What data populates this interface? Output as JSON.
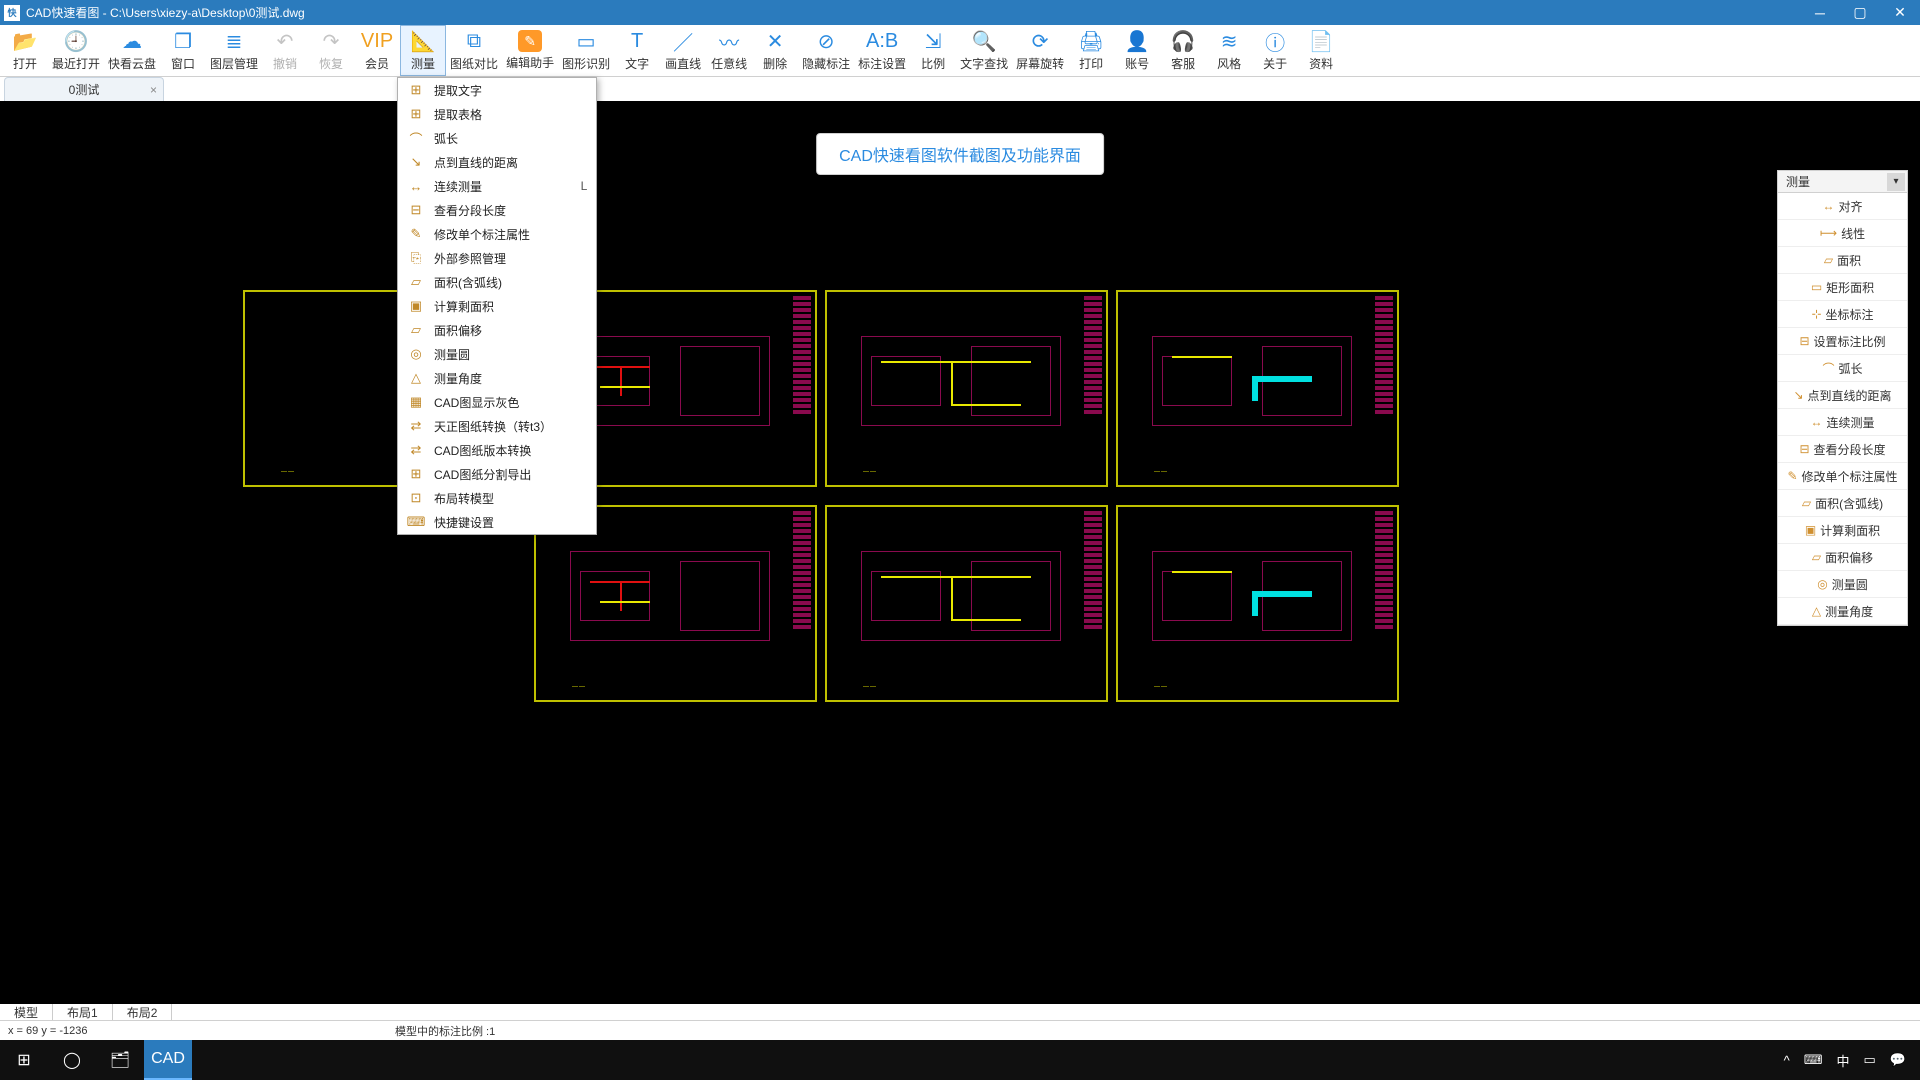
{
  "titlebar": {
    "app_badge": "快",
    "title": "CAD快速看图 - C:\\Users\\xiezy-a\\Desktop\\0测试.dwg"
  },
  "toolbar": [
    {
      "id": "open",
      "label": "打开",
      "icon": "📂"
    },
    {
      "id": "recent",
      "label": "最近打开",
      "icon": "🕘"
    },
    {
      "id": "cloud",
      "label": "快看云盘",
      "icon": "☁"
    },
    {
      "id": "window",
      "label": "窗口",
      "icon": "❐"
    },
    {
      "id": "layers",
      "label": "图层管理",
      "icon": "≣"
    },
    {
      "id": "undo",
      "label": "撤销",
      "icon": "↶",
      "disabled": true
    },
    {
      "id": "redo",
      "label": "恢复",
      "icon": "↷",
      "disabled": true
    },
    {
      "id": "vip",
      "label": "会员",
      "icon": "VIP",
      "vip": true
    },
    {
      "id": "measure",
      "label": "测量",
      "icon": "📐",
      "active": true
    },
    {
      "id": "compare",
      "label": "图纸对比",
      "icon": "⧉"
    },
    {
      "id": "edithelp",
      "label": "编辑助手",
      "icon": "✎",
      "orange": true
    },
    {
      "id": "shape",
      "label": "图形识别",
      "icon": "▭"
    },
    {
      "id": "text",
      "label": "文字",
      "icon": "T"
    },
    {
      "id": "line",
      "label": "画直线",
      "icon": "／"
    },
    {
      "id": "freeline",
      "label": "任意线",
      "icon": "〰"
    },
    {
      "id": "delete",
      "label": "删除",
      "icon": "✕"
    },
    {
      "id": "hidedim",
      "label": "隐藏标注",
      "icon": "⊘"
    },
    {
      "id": "dimset",
      "label": "标注设置",
      "icon": "A:B"
    },
    {
      "id": "scale",
      "label": "比例",
      "icon": "⇲"
    },
    {
      "id": "findtext",
      "label": "文字查找",
      "icon": "🔍"
    },
    {
      "id": "rotate",
      "label": "屏幕旋转",
      "icon": "⟳"
    },
    {
      "id": "print",
      "label": "打印",
      "icon": "🖨"
    },
    {
      "id": "account",
      "label": "账号",
      "icon": "👤"
    },
    {
      "id": "support",
      "label": "客服",
      "icon": "🎧"
    },
    {
      "id": "style",
      "label": "风格",
      "icon": "≋"
    },
    {
      "id": "about",
      "label": "关于",
      "icon": "ⓘ"
    },
    {
      "id": "resources",
      "label": "资料",
      "icon": "📄"
    }
  ],
  "doc_tab": {
    "label": "0测试"
  },
  "dropdown": [
    {
      "icon": "⊞",
      "label": "提取文字"
    },
    {
      "icon": "⊞",
      "label": "提取表格"
    },
    {
      "icon": "⌒",
      "label": "弧长"
    },
    {
      "icon": "↘",
      "label": "点到直线的距离"
    },
    {
      "icon": "↔",
      "label": "连续测量",
      "acc": "L"
    },
    {
      "icon": "⊟",
      "label": "查看分段长度"
    },
    {
      "icon": "✎",
      "label": "修改单个标注属性"
    },
    {
      "icon": "⎘",
      "label": "外部参照管理"
    },
    {
      "icon": "▱",
      "label": "面积(含弧线)"
    },
    {
      "icon": "▣",
      "label": "计算剩面积"
    },
    {
      "icon": "▱",
      "label": "面积偏移"
    },
    {
      "icon": "◎",
      "label": "测量圆"
    },
    {
      "icon": "△",
      "label": "测量角度"
    },
    {
      "icon": "▦",
      "label": "CAD图显示灰色"
    },
    {
      "icon": "⇄",
      "label": "天正图纸转换（转t3）"
    },
    {
      "icon": "⇄",
      "label": "CAD图纸版本转换"
    },
    {
      "icon": "⊞",
      "label": "CAD图纸分割导出"
    },
    {
      "icon": "⊡",
      "label": "布局转模型"
    },
    {
      "icon": "⌨",
      "label": "快捷键设置"
    }
  ],
  "watermark": "CAD快速看图软件截图及功能界面",
  "right_panel": {
    "title": "测量",
    "items": [
      {
        "icon": "↔",
        "label": "对齐"
      },
      {
        "icon": "⟼",
        "label": "线性"
      },
      {
        "icon": "▱",
        "label": "面积"
      },
      {
        "icon": "▭",
        "label": "矩形面积"
      },
      {
        "icon": "⊹",
        "label": "坐标标注"
      },
      {
        "icon": "⊟",
        "label": "设置标注比例"
      },
      {
        "icon": "⌒",
        "label": "弧长"
      },
      {
        "icon": "↘",
        "label": "点到直线的距离"
      },
      {
        "icon": "↔",
        "label": "连续测量"
      },
      {
        "icon": "⊟",
        "label": "查看分段长度"
      },
      {
        "icon": "✎",
        "label": "修改单个标注属性"
      },
      {
        "icon": "▱",
        "label": "面积(含弧线)"
      },
      {
        "icon": "▣",
        "label": "计算剩面积"
      },
      {
        "icon": "▱",
        "label": "面积偏移"
      },
      {
        "icon": "◎",
        "label": "测量圆"
      },
      {
        "icon": "△",
        "label": "测量角度"
      }
    ]
  },
  "layout_tabs": [
    "模型",
    "布局1",
    "布局2"
  ],
  "status": {
    "coords": "x = 69  y = -1236",
    "scale": "模型中的标注比例 :1"
  },
  "taskbar": {
    "tray": [
      "^",
      "⌨",
      "中",
      "▭",
      "💬"
    ]
  },
  "thumb_sig": "——"
}
